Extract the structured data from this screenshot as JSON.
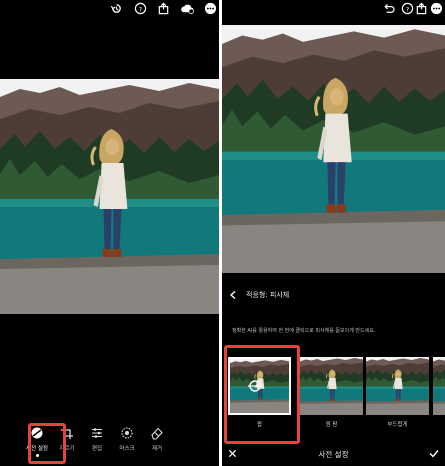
{
  "left_panel": {
    "toolbar_icons": [
      "history-icon",
      "help-icon",
      "share-icon",
      "cloud-icon",
      "more-icon"
    ],
    "tools": [
      {
        "label": "사전 설정",
        "icon": "presets-icon",
        "active": true
      },
      {
        "label": "자르기",
        "icon": "crop-icon",
        "active": false
      },
      {
        "label": "편집",
        "icon": "edit-sliders-icon",
        "active": false
      },
      {
        "label": "마스크",
        "icon": "mask-icon",
        "active": false
      },
      {
        "label": "제거",
        "icon": "eraser-icon",
        "active": false
      }
    ]
  },
  "right_panel": {
    "toolbar_icons": [
      "undo-icon",
      "help-icon",
      "share-icon",
      "more-icon"
    ],
    "section_title": "적응형: 피사체",
    "description": "정확한 AI를 활용하여 한 번에 클릭으로 피사체를 돋보이게 만드세요.",
    "presets": [
      {
        "label": "팝"
      },
      {
        "label": "원 팡"
      },
      {
        "label": "부드럽게"
      },
      {
        "label": ""
      }
    ],
    "bottom_title": "사전 설정"
  },
  "colors": {
    "background": "#000000",
    "highlight": "#e8433b",
    "lake": "#0f7f82"
  }
}
